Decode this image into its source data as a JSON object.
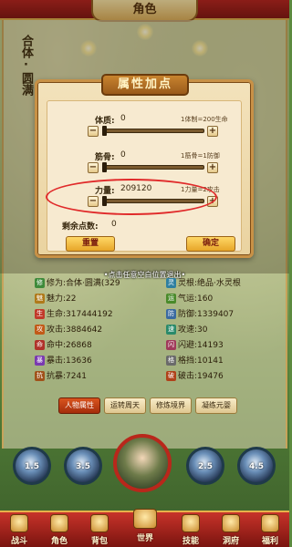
{
  "header": {
    "title": "角色"
  },
  "character": {
    "name_vertical": "合体·圆满"
  },
  "dialog": {
    "title": "属性加点",
    "attributes": [
      {
        "key": "tizhi",
        "label": "体质:",
        "value": "0",
        "hint": "1体制=200生命"
      },
      {
        "key": "jingu",
        "label": "筋骨:",
        "value": "0",
        "hint": "1筋骨=1防御"
      },
      {
        "key": "liliang",
        "label": "力量:",
        "value": "209120",
        "hint": "1力量=2攻击"
      }
    ],
    "remaining_label": "剩余点数:",
    "remaining_value": "0",
    "reset_label": "重置",
    "confirm_label": "确定",
    "minus_symbol": "−",
    "plus_symbol": "+"
  },
  "exit_hint": "•点击任意空白位置退出•",
  "stats": {
    "left": [
      {
        "icon_label": "修",
        "label": "修为:",
        "value": "合体·圆满(329",
        "icon_color": "#3e8a3a"
      },
      {
        "icon_label": "魅",
        "label": "魅力:",
        "value": "22",
        "icon_color": "#b07a1a"
      },
      {
        "icon_label": "生",
        "label": "生命:",
        "value": "317444192",
        "icon_color": "#c13a2a"
      },
      {
        "icon_label": "攻",
        "label": "攻击:",
        "value": "3884642",
        "icon_color": "#c25a18"
      },
      {
        "icon_label": "命",
        "label": "命中:",
        "value": "26868",
        "icon_color": "#b0322a"
      },
      {
        "icon_label": "暴",
        "label": "暴击:",
        "value": "13636",
        "icon_color": "#7a3ab0"
      },
      {
        "icon_label": "抗",
        "label": "抗暴:",
        "value": "7241",
        "icon_color": "#a0521a"
      }
    ],
    "right": [
      {
        "icon_label": "灵",
        "label": "灵根:",
        "value": "绝品·水灵根",
        "icon_color": "#2f7fa0"
      },
      {
        "icon_label": "运",
        "label": "气运:",
        "value": "160",
        "icon_color": "#4a8a2a"
      },
      {
        "icon_label": "防",
        "label": "防御:",
        "value": "1339407",
        "icon_color": "#3a6aa0"
      },
      {
        "icon_label": "速",
        "label": "攻速:",
        "value": "30",
        "icon_color": "#2a8a6a"
      },
      {
        "icon_label": "闪",
        "label": "闪避:",
        "value": "14193",
        "icon_color": "#a03a5a"
      },
      {
        "icon_label": "格",
        "label": "格挡:",
        "value": "10141",
        "icon_color": "#6a6a6a"
      },
      {
        "icon_label": "破",
        "label": "破击:",
        "value": "19476",
        "icon_color": "#b0421a"
      }
    ]
  },
  "tabs": [
    "人物属性",
    "运转周天",
    "修炼境界",
    "凝练元婴"
  ],
  "skills": [
    "1.5",
    "3.5",
    "2.5",
    "4.5"
  ],
  "nav": [
    "战斗",
    "角色",
    "背包",
    "世界",
    "技能",
    "洞府",
    "福利"
  ]
}
